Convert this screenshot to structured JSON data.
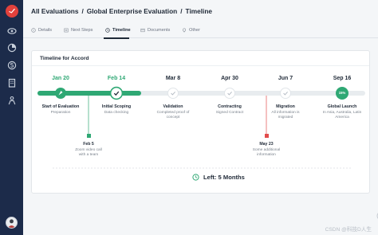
{
  "colors": {
    "sidebar_bg": "#1c2b4a",
    "accent_green": "#2fa874",
    "flag_red": "#e24b4b",
    "line_light": "#e8ecef",
    "gray_text": "#7a828c"
  },
  "sidebar": {
    "items": [
      {
        "name": "logo",
        "icon": "brand-logo-icon"
      },
      {
        "name": "eye",
        "icon": "eye-icon"
      },
      {
        "name": "pie",
        "icon": "pie-chart-icon"
      },
      {
        "name": "money",
        "icon": "currency-icon"
      },
      {
        "name": "building",
        "icon": "building-icon"
      },
      {
        "name": "person",
        "icon": "person-icon"
      }
    ],
    "avatar": "user-avatar"
  },
  "breadcrumb": {
    "item1": "All Evaluations",
    "item2": "Global Enterprise Evaluation",
    "item3": "Timeline",
    "sep": "/"
  },
  "tabs": [
    {
      "label": "Details",
      "icon": "info-icon",
      "active": false
    },
    {
      "label": "Next Steps",
      "icon": "next-steps-icon",
      "active": false
    },
    {
      "label": "Timeline",
      "icon": "clock-icon",
      "active": true
    },
    {
      "label": "Documents",
      "icon": "document-icon",
      "active": false
    },
    {
      "label": "Other",
      "icon": "lightbulb-icon",
      "active": false
    }
  ],
  "timeline": {
    "title": "Timeline for Accord",
    "milestones": [
      {
        "date": "Jan 20",
        "title": "Start of Evaluation",
        "sub": "Preparation",
        "state": "complete",
        "icon": "rocket-icon"
      },
      {
        "date": "Feb 14",
        "title": "Initial Scoping",
        "sub": "Data checking",
        "state": "current",
        "icon": "check-icon"
      },
      {
        "date": "Mar 8",
        "title": "Validation",
        "sub": "Completed proof of concept",
        "state": "upcoming",
        "icon": "check-icon"
      },
      {
        "date": "Apr 30",
        "title": "Contracting",
        "sub": "Signed Contract",
        "state": "upcoming",
        "icon": "check-icon"
      },
      {
        "date": "Jun 7",
        "title": "Migration",
        "sub": "All information is migrated",
        "state": "upcoming",
        "icon": "check-icon"
      },
      {
        "date": "Sep 16",
        "title": "Global Launch",
        "sub": "In Asia, Australia, Latin America",
        "state": "final",
        "badge": "15%"
      }
    ],
    "flags": [
      {
        "date": "Feb 5",
        "sub": "Zoom video call with a team",
        "color": "green"
      },
      {
        "date": "May 23",
        "sub": "Some additional information",
        "color": "red"
      }
    ],
    "left_label": "Left: 5 Months"
  },
  "watermark": "CSDN @科技D人生"
}
